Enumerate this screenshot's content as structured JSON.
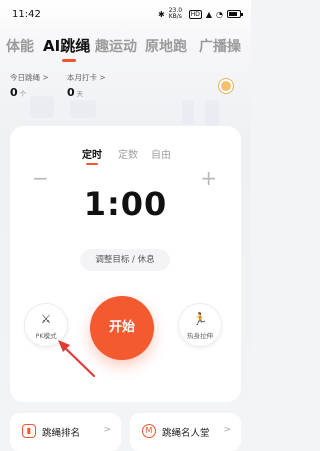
{
  "status_bar": {
    "time": "11:42",
    "bluetooth_icon": "bluetooth-icon",
    "network_speed": "23.0 KB/s",
    "network_type": "HD",
    "battery_level": 0.75
  },
  "top_tabs": [
    {
      "label": "体能",
      "active": false
    },
    {
      "label": "AI跳绳",
      "active": true
    },
    {
      "label": "趣运动",
      "active": false
    },
    {
      "label": "原地跑",
      "active": false
    },
    {
      "label": "广播操",
      "active": false
    }
  ],
  "stats": {
    "today": {
      "label": "今日跳绳 >",
      "value": "0",
      "unit": "个"
    },
    "month": {
      "label": "本月打卡 >",
      "value": "0",
      "unit": "天"
    }
  },
  "card": {
    "mode_tabs": [
      {
        "label": "定时",
        "active": true
      },
      {
        "label": "定数",
        "active": false
      },
      {
        "label": "自由",
        "active": false
      }
    ],
    "minus": "−",
    "plus": "+",
    "timer": "1:00",
    "adjust_label": "调整目标 / 休息",
    "pk_label": "PK模式",
    "start_label": "开始",
    "warmup_label": "热身拉伸"
  },
  "bottom": {
    "ranking_label": "跳绳排名",
    "hall_label": "跳绳名人堂",
    "chevron": ">"
  },
  "colors": {
    "accent": "#f35a2f",
    "annotation_arrow": "#e53935"
  }
}
